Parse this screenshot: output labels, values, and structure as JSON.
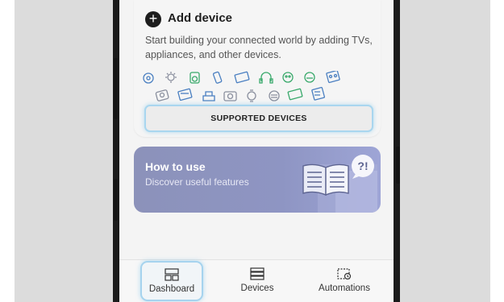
{
  "add_device": {
    "title": "Add device",
    "description": "Start building your connected world by adding TVs, appliances, and other devices.",
    "supported_button": "SUPPORTED DEVICES",
    "device_icons": [
      "speaker-icon",
      "lamp-icon",
      "washer-icon",
      "phone-icon",
      "tv-icon",
      "headphones-icon",
      "vacuum-icon",
      "robot-icon",
      "camera-icon",
      "oven-icon",
      "monitor-icon",
      "printer-icon",
      "camera2-icon",
      "wearable-icon",
      "fridge-icon",
      "dishwasher-icon"
    ]
  },
  "how_to_use": {
    "title": "How to use",
    "subtitle": "Discover useful features"
  },
  "bottom_nav": {
    "items": [
      {
        "label": "Dashboard",
        "icon": "dashboard-icon",
        "active": true
      },
      {
        "label": "Devices",
        "icon": "devices-icon",
        "active": false
      },
      {
        "label": "Automations",
        "icon": "automations-icon",
        "active": false
      }
    ]
  },
  "colors": {
    "accent_highlight": "#a6d3ee",
    "card_purple": "#8e95c3",
    "icon_green": "#39a96b",
    "icon_blue": "#4a7fc1",
    "icon_gray": "#8a8f9e"
  }
}
